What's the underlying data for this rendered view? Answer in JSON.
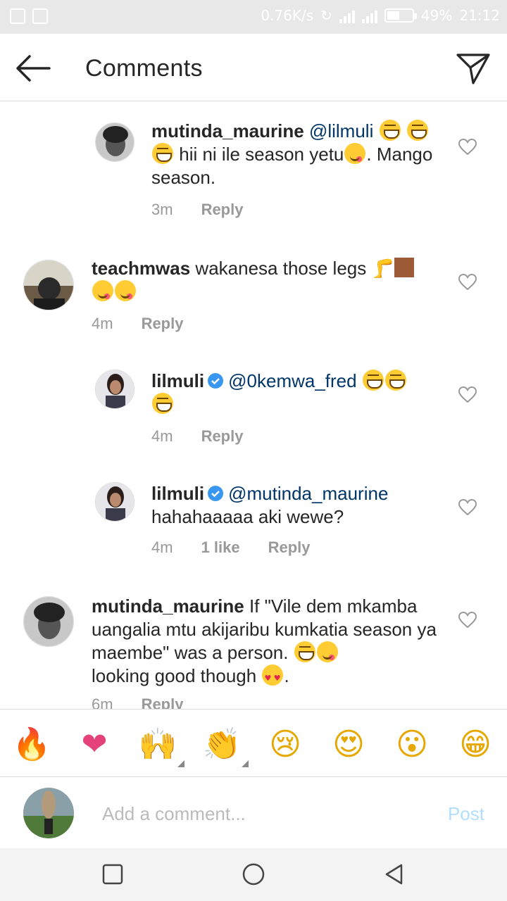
{
  "status_bar": {
    "network_speed": "0.76K/s",
    "battery": "49%",
    "battery_level": 0.49,
    "time": "21:12"
  },
  "header": {
    "title": "Comments"
  },
  "comments": [
    {
      "username": "mutinda_maurine",
      "mention": "@lilmuli",
      "text": "hii ni ile season yetu",
      "text2": ". Mango season.",
      "time": "3m",
      "reply_label": "Reply"
    },
    {
      "username": "teachmwas",
      "text": "wakanesa those legs 🦵",
      "time": "4m",
      "reply_label": "Reply"
    },
    {
      "username": "lilmuli",
      "mention": "@0kemwa_fred",
      "time": "4m",
      "reply_label": "Reply"
    },
    {
      "username": "lilmuli",
      "mention": "@mutinda_maurine",
      "text": "hahahaaaaa aki wewe?",
      "time": "4m",
      "likes": "1 like",
      "reply_label": "Reply"
    },
    {
      "username": "mutinda_maurine",
      "text": "If \"Vile dem mkamba uangalia mtu akijaribu kumkatia season ya maembe\" was a person.",
      "text2": "looking good though",
      "text3": ".",
      "time": "6m",
      "reply_label": "Reply"
    }
  ],
  "emoji_bar": [
    "🔥",
    "❤",
    "🙌",
    "👏",
    "😢",
    "😍",
    "😮",
    "😁"
  ],
  "input": {
    "placeholder": "Add a comment...",
    "post_label": "Post"
  },
  "colors": {
    "mention": "#003569",
    "meta": "#999999",
    "post_disabled": "#b2dffc",
    "verified": "#3897f0"
  }
}
